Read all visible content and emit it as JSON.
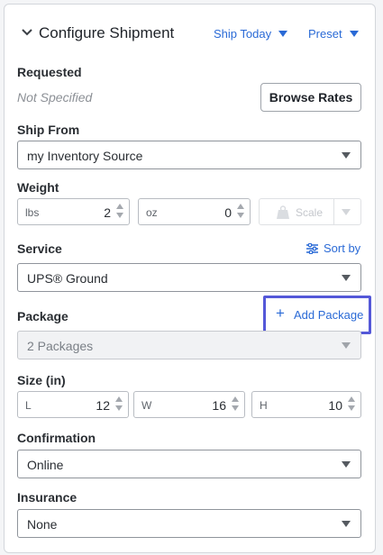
{
  "header": {
    "title": "Configure Shipment",
    "ship_date_label": "Ship Today",
    "preset_label": "Preset"
  },
  "requested": {
    "label": "Requested",
    "value": "Not Specified",
    "browse_button": "Browse Rates"
  },
  "ship_from": {
    "label": "Ship From",
    "value": "my Inventory Source"
  },
  "weight": {
    "label": "Weight",
    "lbs_unit": "lbs",
    "lbs_value": "2",
    "oz_unit": "oz",
    "oz_value": "0",
    "scale_label": "Scale"
  },
  "service": {
    "label": "Service",
    "sort_label": "Sort by",
    "value": "UPS® Ground"
  },
  "package": {
    "label": "Package",
    "add_label": "Add Package",
    "value": "2 Packages"
  },
  "size": {
    "label": "Size (in)",
    "l_unit": "L",
    "l_value": "12",
    "w_unit": "W",
    "w_value": "16",
    "h_unit": "H",
    "h_value": "10"
  },
  "confirmation": {
    "label": "Confirmation",
    "value": "Online"
  },
  "insurance": {
    "label": "Insurance",
    "value": "None"
  },
  "colors": {
    "accent": "#2a6ad6",
    "highlight": "#5458d8"
  }
}
